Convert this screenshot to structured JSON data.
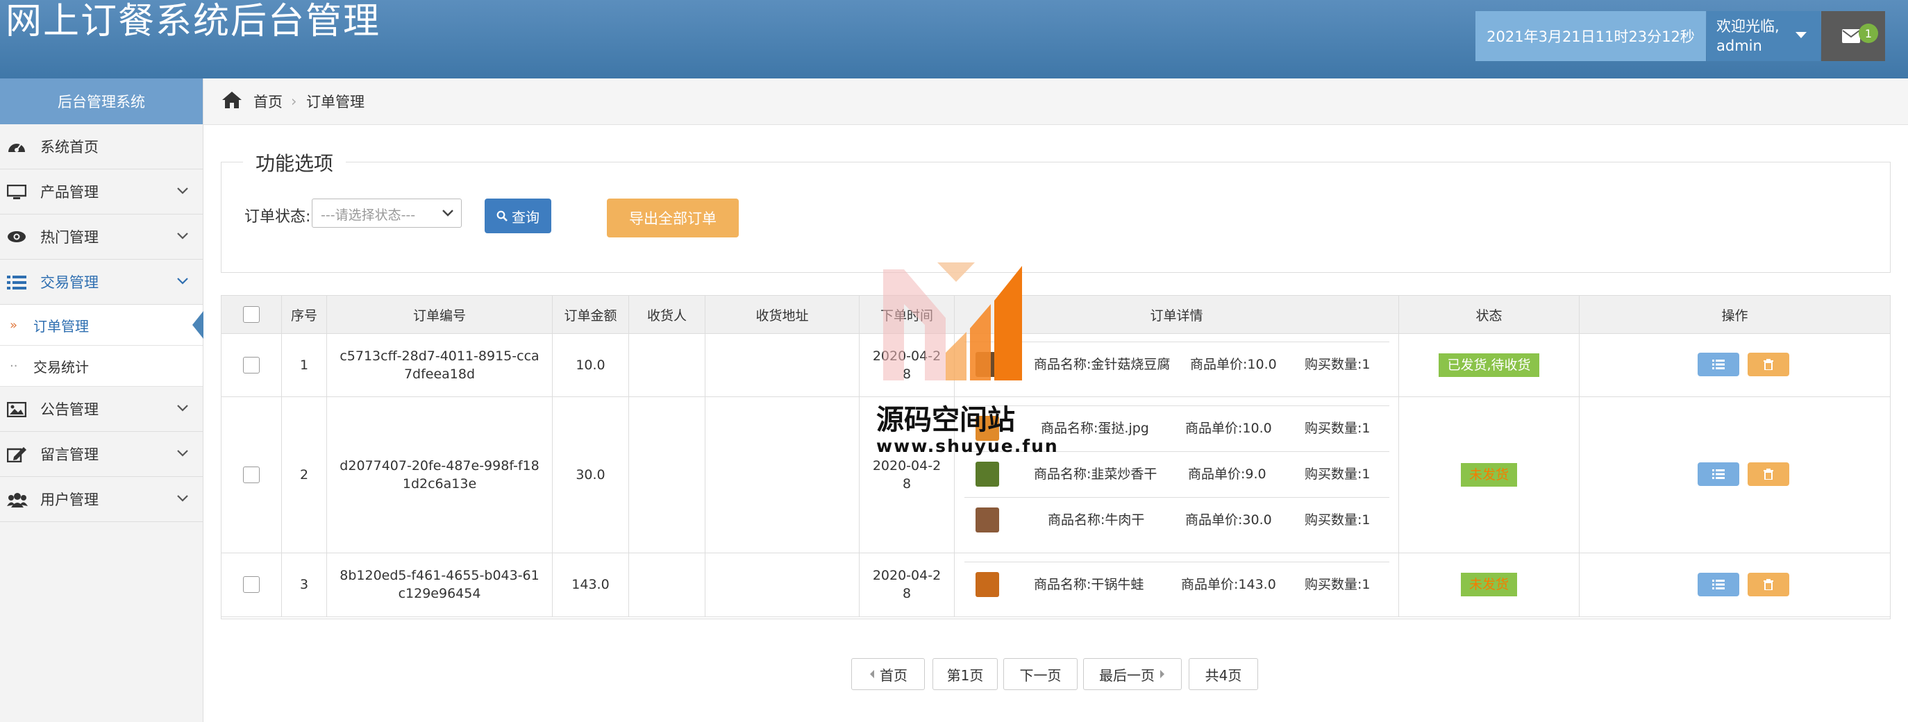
{
  "header": {
    "title": "网上订餐系统后台管理",
    "datetime": "2021年3月21日11时23分12秒",
    "welcome": "欢迎光临,",
    "username": "admin",
    "mail_count": "1"
  },
  "sidebar": {
    "heading": "后台管理系统",
    "items": [
      {
        "label": "系统首页",
        "icon": "dashboard-icon"
      },
      {
        "label": "产品管理",
        "icon": "desktop-icon"
      },
      {
        "label": "热门管理",
        "icon": "eye-icon"
      },
      {
        "label": "交易管理",
        "icon": "list-icon"
      },
      {
        "label": "公告管理",
        "icon": "picture-icon"
      },
      {
        "label": "留言管理",
        "icon": "edit-icon"
      },
      {
        "label": "用户管理",
        "icon": "users-icon"
      }
    ],
    "sub_items": [
      {
        "label": "订单管理",
        "marker": "»"
      },
      {
        "label": "交易统计",
        "marker": "··"
      }
    ]
  },
  "breadcrumb": {
    "home": "首页",
    "separator": "›",
    "current": "订单管理"
  },
  "filter": {
    "legend": "功能选项",
    "status_label": "订单状态:",
    "status_placeholder": "---请选择状态---",
    "query_label": "查询",
    "export_label": "导出全部订单"
  },
  "table": {
    "headers": [
      "",
      "序号",
      "订单编号",
      "订单金额",
      "收货人",
      "收货地址",
      "下单时间",
      "订单详情",
      "状态",
      "操作"
    ],
    "detail_labels": {
      "name": "商品名称:",
      "price": "商品单价:",
      "qty": "购买数量:"
    },
    "rows": [
      {
        "index": "1",
        "order_no": "c5713cff-28d7-4011-8915-cca7dfeea18d",
        "amount": "10.0",
        "receiver": "",
        "address": "",
        "date": "2020-04-28",
        "items": [
          {
            "name": "金针菇烧豆腐",
            "price": "10.0",
            "qty": "1"
          }
        ],
        "status": "已发货,待收货",
        "status_color": "#8bc34a"
      },
      {
        "index": "2",
        "order_no": "d2077407-20fe-487e-998f-f181d2c6a13e",
        "amount": "30.0",
        "receiver": "",
        "address": "",
        "date": "2020-04-28",
        "items": [
          {
            "name": "蛋挞.jpg",
            "price": "10.0",
            "qty": "1"
          },
          {
            "name": "韭菜炒香干",
            "price": "9.0",
            "qty": "1"
          },
          {
            "name": "牛肉干",
            "price": "30.0",
            "qty": "1"
          }
        ],
        "status": "未发货",
        "status_color": "#8bc34a"
      },
      {
        "index": "3",
        "order_no": "8b120ed5-f461-4655-b043-61c129e96454",
        "amount": "143.0",
        "receiver": "",
        "address": "",
        "date": "2020-04-28",
        "items": [
          {
            "name": "干锅牛蛙",
            "price": "143.0",
            "qty": "1"
          }
        ],
        "status": "未发货",
        "status_color": "#8bc34a"
      }
    ]
  },
  "pager": {
    "first": "首页",
    "current": "第1页",
    "next": "下一页",
    "last": "最后一页",
    "total": "共4页"
  },
  "watermark": {
    "text": "源码空间站",
    "url": "www.shuyue.fun"
  },
  "colors": {
    "header": "#4a80b2",
    "accent": "#3e7dc0",
    "warning": "#f2b25c",
    "status_green": "#8bc34a"
  }
}
